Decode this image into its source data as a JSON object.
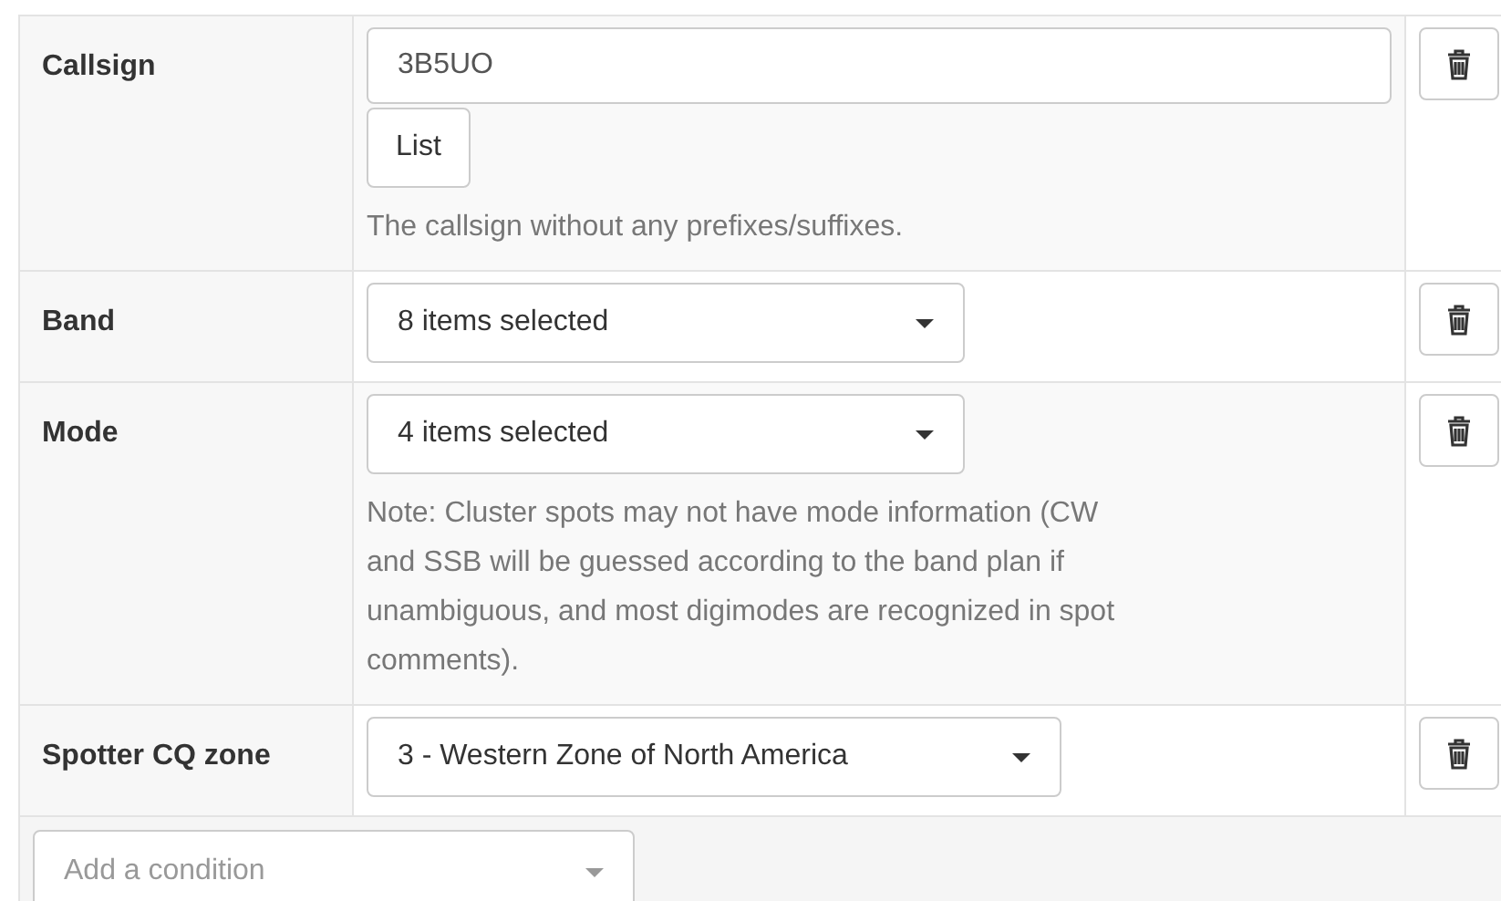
{
  "conditions": [
    {
      "kind": "text",
      "label": "Callsign",
      "value": "3B5UO",
      "button": "List",
      "help": "The callsign without any prefixes/suffixes."
    },
    {
      "kind": "select",
      "label": "Band",
      "value": "8 items selected"
    },
    {
      "kind": "select",
      "label": "Mode",
      "value": "4 items selected",
      "help": "Note: Cluster spots may not have mode information (CW and SSB will be guessed according to the band plan if unambiguous, and most digimodes are recognized in spot comments)."
    },
    {
      "kind": "select",
      "label": "Spotter CQ zone",
      "value": "3 - Western Zone of North America"
    }
  ],
  "add_condition": {
    "placeholder": "Add a condition"
  }
}
